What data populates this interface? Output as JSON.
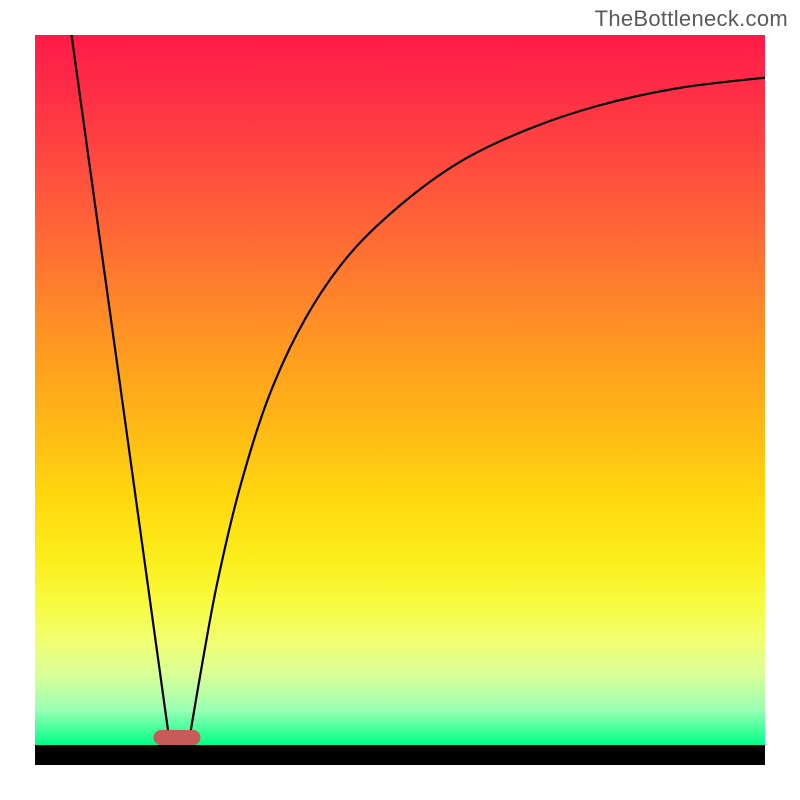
{
  "watermark": "TheBottleneck.com",
  "chart_data": {
    "type": "line",
    "title": "",
    "xlabel": "",
    "ylabel": "",
    "xlim": [
      0,
      100
    ],
    "ylim": [
      0,
      100
    ],
    "background_gradient": {
      "orientation": "vertical",
      "stops": [
        {
          "pos": 0,
          "color": "#ff1a48"
        },
        {
          "pos": 18,
          "color": "#ff4a3f"
        },
        {
          "pos": 42,
          "color": "#ff9323"
        },
        {
          "pos": 65,
          "color": "#ffd70e"
        },
        {
          "pos": 80,
          "color": "#f7fb3f"
        },
        {
          "pos": 95,
          "color": "#9affb4"
        },
        {
          "pos": 100,
          "color": "#00ff88"
        }
      ]
    },
    "series": [
      {
        "name": "left-line",
        "type": "line",
        "x": [
          5,
          18.5
        ],
        "values": [
          100,
          0
        ]
      },
      {
        "name": "right-curve",
        "type": "line",
        "x": [
          21,
          23,
          25,
          28,
          32,
          37,
          43,
          50,
          58,
          67,
          77,
          88,
          100
        ],
        "values": [
          0,
          12,
          23,
          36,
          49,
          60,
          69,
          76,
          82,
          86.5,
          90,
          92.5,
          94
        ]
      }
    ],
    "marker": {
      "x": 19.5,
      "y": 0,
      "color": "#c85a5a",
      "shape": "rounded-rect"
    }
  }
}
